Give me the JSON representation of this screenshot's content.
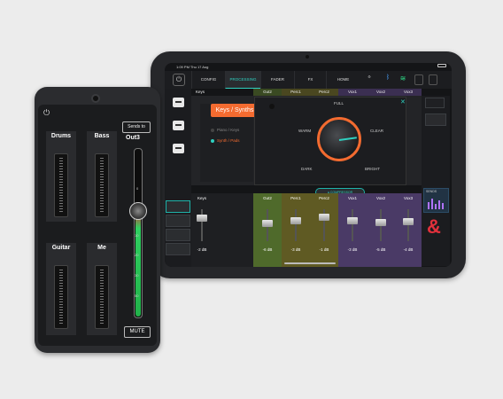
{
  "tablet": {
    "status": {
      "time": "1:09 PM   Thu 17 Aug"
    },
    "nav": {
      "tabs": [
        "CONFIG",
        "PROCESSING",
        "FADER",
        "FX",
        "HOME"
      ],
      "active_tab": "PROCESSING",
      "icons": [
        "power-icon",
        "bluetooth-icon",
        "wifi-icon",
        "settings-icon"
      ]
    },
    "channel_strip": [
      "Keys",
      "Gut2",
      "Perc1",
      "Perc2",
      "Vox1",
      "Vox2",
      "Vox3"
    ],
    "preset_panel": {
      "title": "Keys / Synths",
      "items": [
        {
          "label": "Piano / Keys",
          "active": false
        },
        {
          "label": "Synth / Pads",
          "active": true
        }
      ]
    },
    "knob": {
      "labels": {
        "top": "FULL",
        "left": "WARM",
        "right": "CLEAR",
        "bottom_left": "DARK",
        "bottom_right": "BRIGHT"
      },
      "close_symbol": "✕",
      "compressor_label": "COMPRESSOR"
    },
    "sends_label": "SENDS",
    "faders": [
      {
        "name": "Keys",
        "db": "-2 dB",
        "color": "#1e1f22",
        "level": 0.72
      },
      {
        "name": "Gut2",
        "db": "-6 dB",
        "color": "#4f6a2b",
        "level": 0.55
      },
      {
        "name": "Perc1",
        "db": "-3 dB",
        "color": "#5f5a23",
        "level": 0.65
      },
      {
        "name": "Perc2",
        "db": "-1 dB",
        "color": "#5f5a23",
        "level": 0.75
      },
      {
        "name": "Vox1",
        "db": "-3 dB",
        "color": "#4a3a66",
        "level": 0.65
      },
      {
        "name": "Vox2",
        "db": "-5 dB",
        "color": "#4a3a66",
        "level": 0.58
      },
      {
        "name": "Vox3",
        "db": "-4 dB",
        "color": "#4a3a66",
        "level": 0.62
      }
    ],
    "brand_mark": "&",
    "colors": {
      "accent": "#2fd0c0",
      "orange": "#f36b30",
      "brand": "#e2313c"
    }
  },
  "phone": {
    "sends_button": "Sends to",
    "aux_name": "Out3",
    "channels": [
      {
        "label": "Drums"
      },
      {
        "label": "Bass"
      },
      {
        "label": "Guitar"
      },
      {
        "label": "Me"
      }
    ],
    "scale_marks": [
      "0",
      "5",
      "10",
      "20",
      "30",
      "50"
    ],
    "master_level": 0.62,
    "mute_label": "MUTE"
  }
}
